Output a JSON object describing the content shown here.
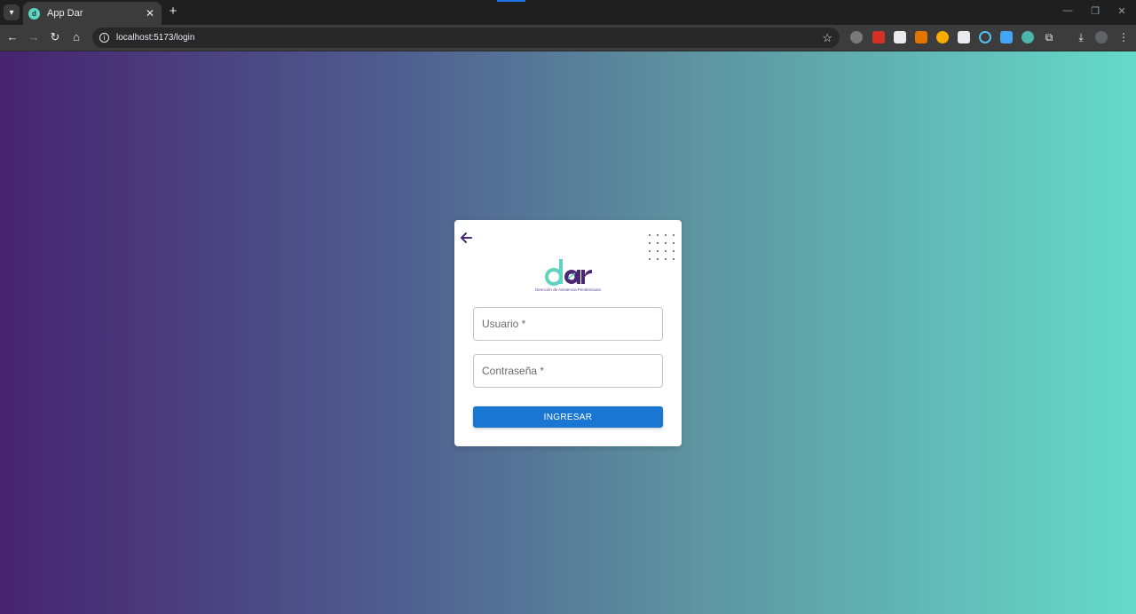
{
  "browser": {
    "tab": {
      "title": "App Dar",
      "favicon": "dar-logo-favicon"
    },
    "address": {
      "url": "localhost:5173/login"
    },
    "extensions": [
      {
        "name": "extension-1-icon",
        "color": "#a0a0a0"
      },
      {
        "name": "extension-2-icon",
        "color": "#d93025"
      },
      {
        "name": "extension-3-icon",
        "color": "#e8eaed"
      },
      {
        "name": "extension-4-icon",
        "color": "#e37400"
      },
      {
        "name": "extension-5-icon",
        "color": "#f9ab00"
      },
      {
        "name": "extension-6-icon",
        "color": "#e8eaed"
      },
      {
        "name": "extension-7-icon",
        "color": "#4fc3f7"
      },
      {
        "name": "extension-8-icon",
        "color": "#42a5f5"
      },
      {
        "name": "extension-9-icon",
        "color": "#4db6ac"
      }
    ]
  },
  "login": {
    "username_placeholder": "Usuario *",
    "password_placeholder": "Contraseña *",
    "submit_label": "INGRESAR",
    "logo_caption": "Dirección de Asistencia Penitenciaria",
    "logo_text": "dar"
  },
  "colors": {
    "gradient_start": "#46246f",
    "gradient_end": "#65dac8",
    "primary_button": "#1976d2",
    "brand_purple": "#4b2673",
    "brand_teal": "#5fd3c0"
  }
}
